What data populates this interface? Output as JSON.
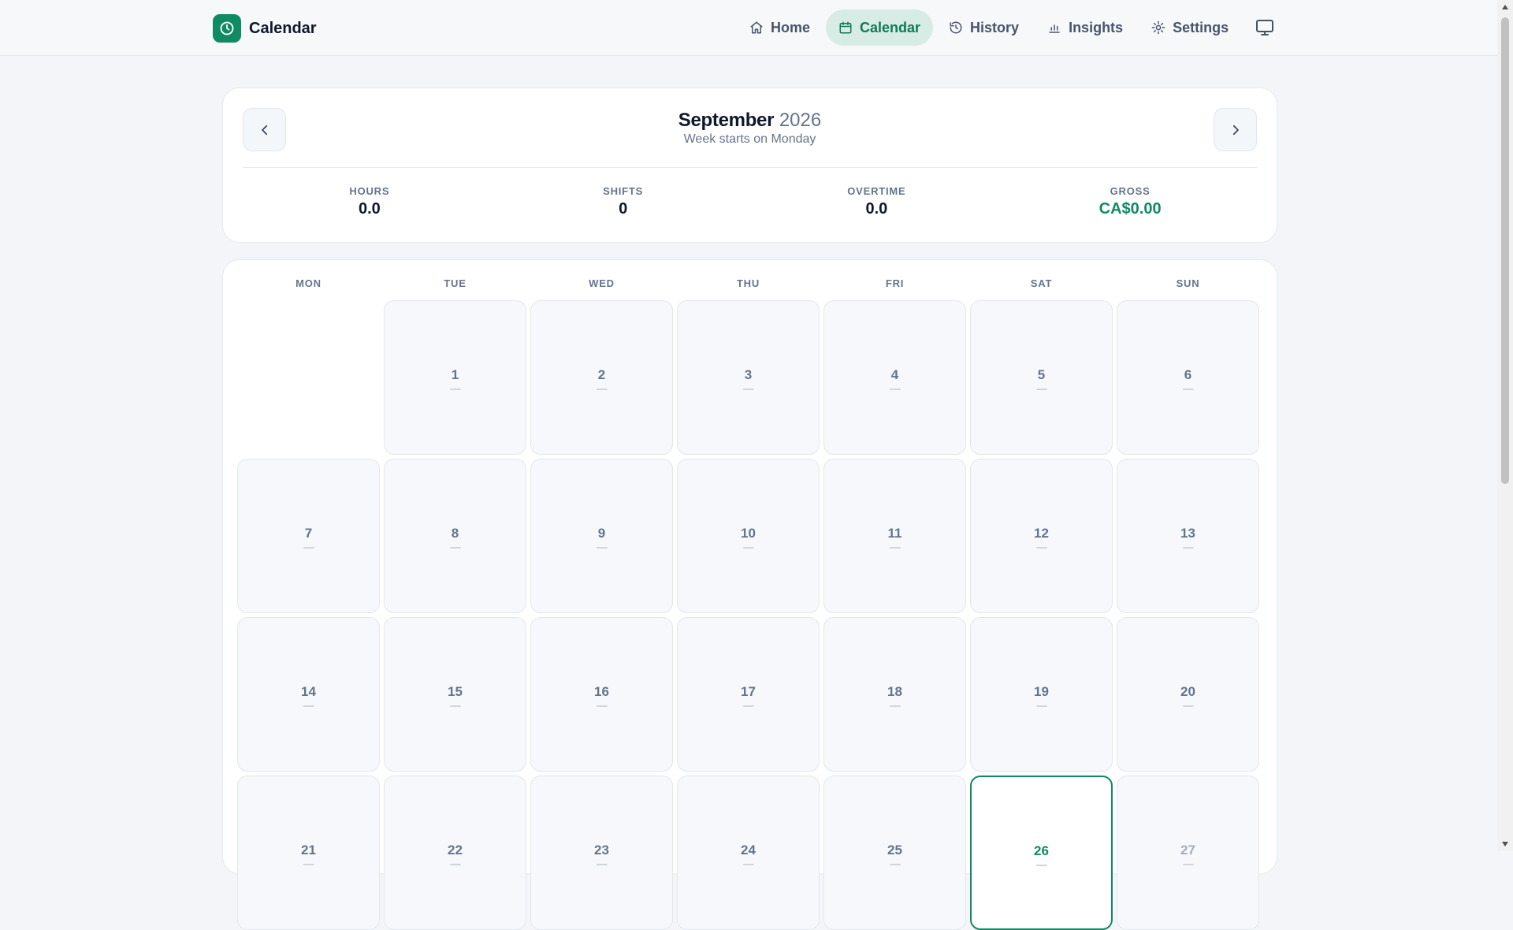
{
  "app": {
    "title": "Calendar"
  },
  "nav": {
    "items": [
      {
        "label": "Home",
        "icon": "home-icon",
        "active": false
      },
      {
        "label": "Calendar",
        "icon": "calendar-icon",
        "active": true
      },
      {
        "label": "History",
        "icon": "history-icon",
        "active": false
      },
      {
        "label": "Insights",
        "icon": "bar-chart-icon",
        "active": false
      },
      {
        "label": "Settings",
        "icon": "gear-icon",
        "active": false
      }
    ],
    "display_icon": "monitor-icon"
  },
  "summary": {
    "month": "September",
    "year": "2026",
    "week_start_note": "Week starts on Monday",
    "stats": [
      {
        "label": "HOURS",
        "value": "0.0"
      },
      {
        "label": "SHIFTS",
        "value": "0"
      },
      {
        "label": "OVERTIME",
        "value": "0.0"
      },
      {
        "label": "GROSS",
        "value": "CA$0.00"
      }
    ]
  },
  "calendar": {
    "weekdays": [
      "MON",
      "TUE",
      "WED",
      "THU",
      "FRI",
      "SAT",
      "SUN"
    ],
    "days": [
      "",
      "1",
      "2",
      "3",
      "4",
      "5",
      "6",
      "7",
      "8",
      "9",
      "10",
      "11",
      "12",
      "13",
      "14",
      "15",
      "16",
      "17",
      "18",
      "19",
      "20",
      "21",
      "22",
      "23",
      "24",
      "25",
      "26",
      "27"
    ],
    "today": "26"
  },
  "colors": {
    "accent": "#0f8a63",
    "active_nav_bg": "#d7ece4"
  }
}
